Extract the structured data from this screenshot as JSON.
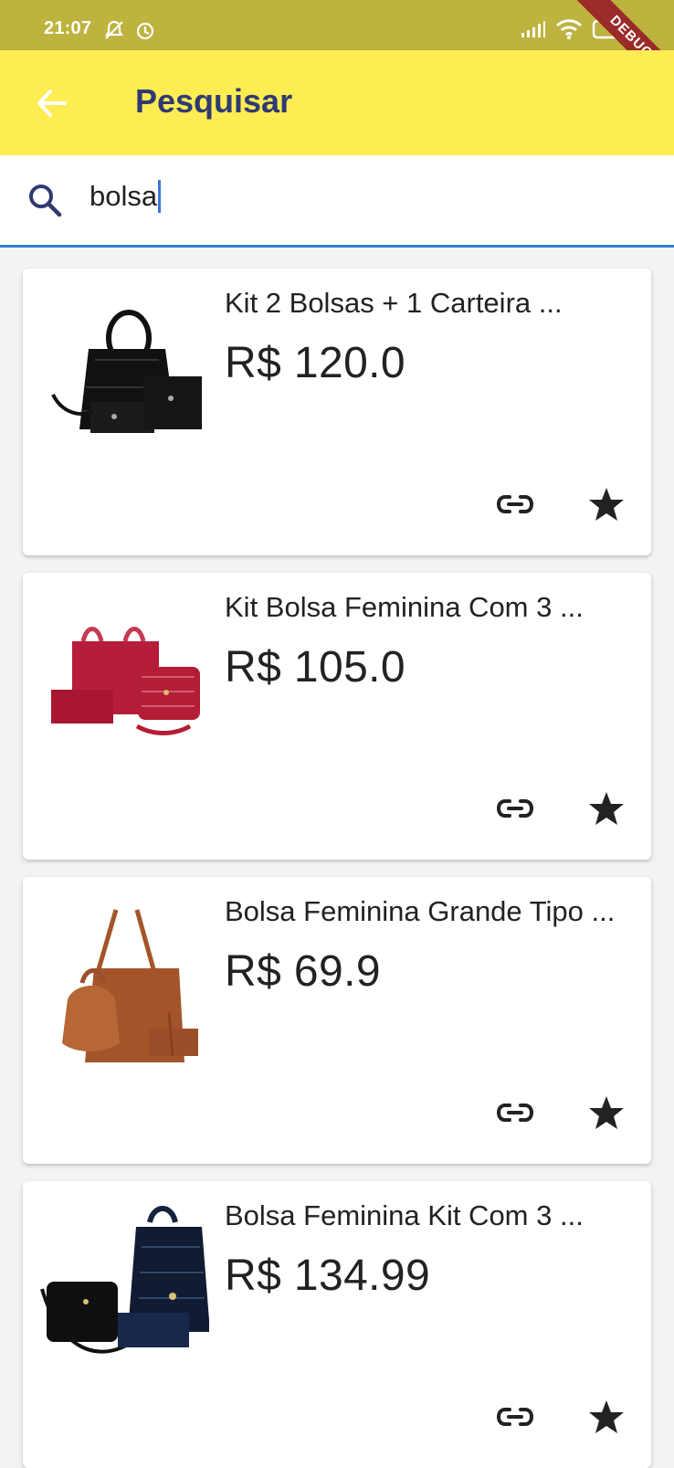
{
  "status_bar": {
    "time": "21:07",
    "debug_label": "DEBUG"
  },
  "app_bar": {
    "title": "Pesquisar",
    "back_icon": "arrow-back-icon"
  },
  "search": {
    "value": "bolsa",
    "icon": "search-icon"
  },
  "products": [
    {
      "title": "Kit 2 Bolsas + 1 Carteira ...",
      "price": "R$ 120.0",
      "image_color": "#111111"
    },
    {
      "title": "Kit Bolsa Feminina Com 3 ...",
      "price": "R$ 105.0",
      "image_color": "#b51d3a"
    },
    {
      "title": "Bolsa Feminina Grande Tipo ...",
      "price": "R$ 69.9",
      "image_color": "#9a4f2a"
    },
    {
      "title": "Bolsa Feminina Kit Com 3 ...",
      "price": "R$ 134.99",
      "image_color": "#15233e"
    }
  ],
  "icons": {
    "link": "link-icon",
    "favorite": "star-icon"
  },
  "colors": {
    "status_bar": "#bdb33f",
    "app_bar": "#fdec52",
    "title": "#2f3a73",
    "search_underline": "#2f83d6"
  }
}
